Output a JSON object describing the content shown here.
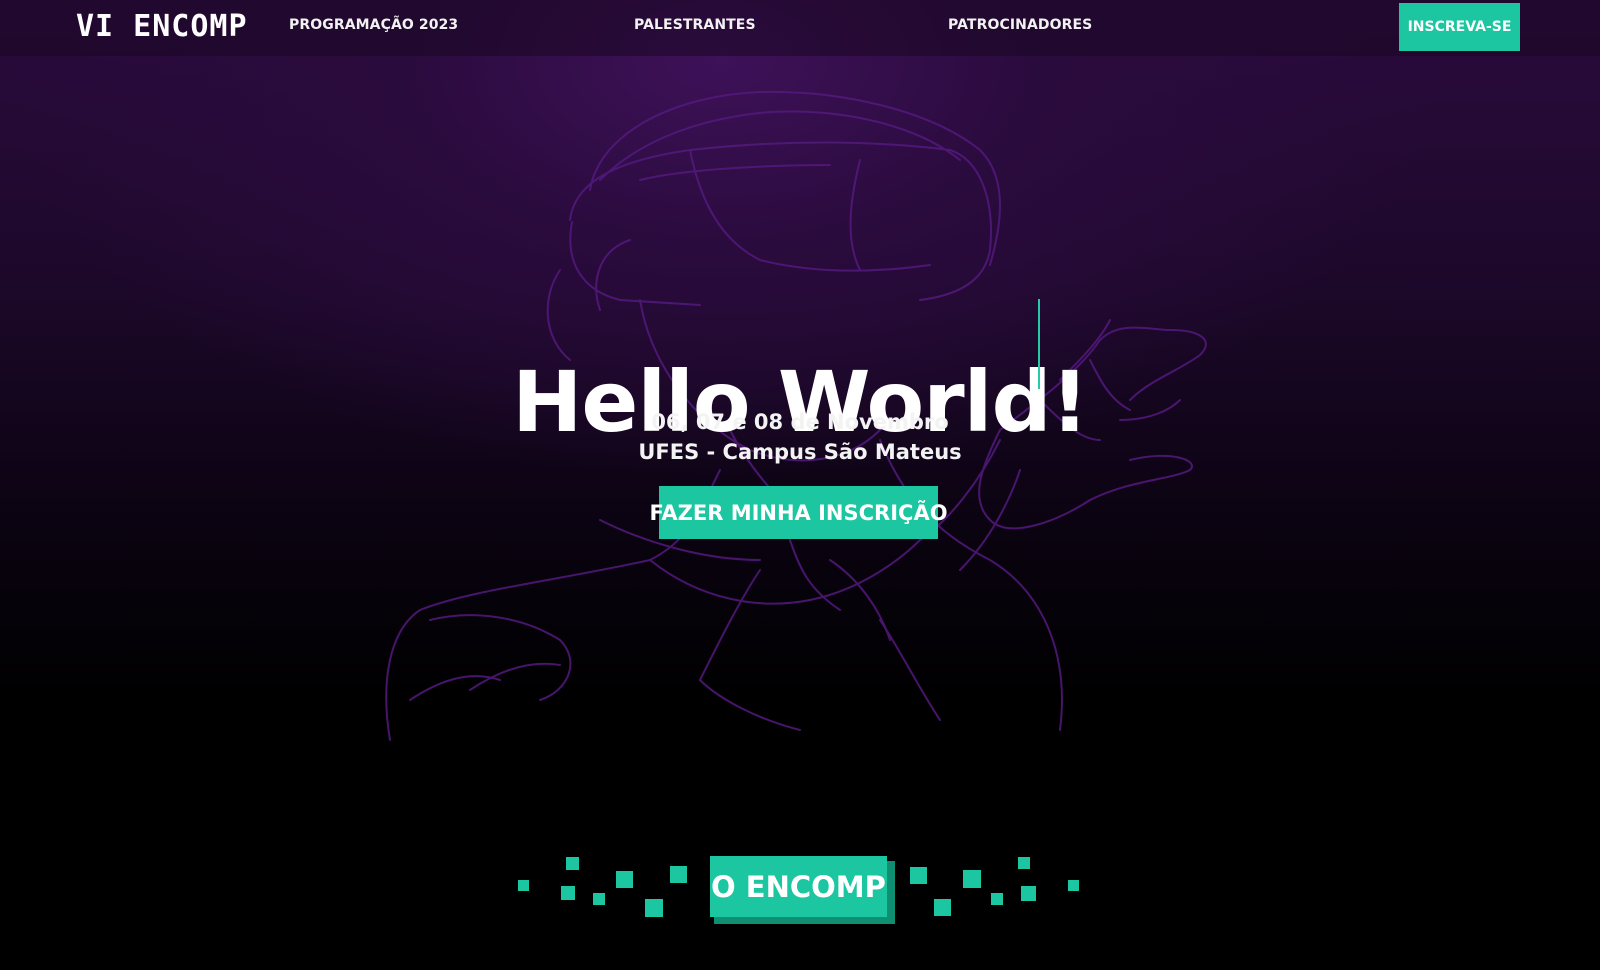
{
  "header": {
    "logo_text": "VI ENCOMP",
    "nav": [
      {
        "label": "PROGRAMAÇÃO 2023"
      },
      {
        "label": "PALESTRANTES"
      },
      {
        "label": "PATROCINADORES"
      }
    ],
    "cta_label": "INSCREVA-SE"
  },
  "hero": {
    "title": "Hello World!",
    "date": "06, 07 e 08 de Novembro",
    "location": "UFES - Campus São Mateus",
    "cta_label": "FAZER MINHA INSCRIÇÃO",
    "background_illustration": "vr-headset-person-line-art"
  },
  "section": {
    "heading": "O ENCOMP"
  },
  "colors": {
    "accent": "#1cc6a0",
    "accent_dark": "#0f8f71",
    "hero_purple": "#3e1158",
    "sketch_line": "#5a1f86",
    "background": "#000000"
  }
}
